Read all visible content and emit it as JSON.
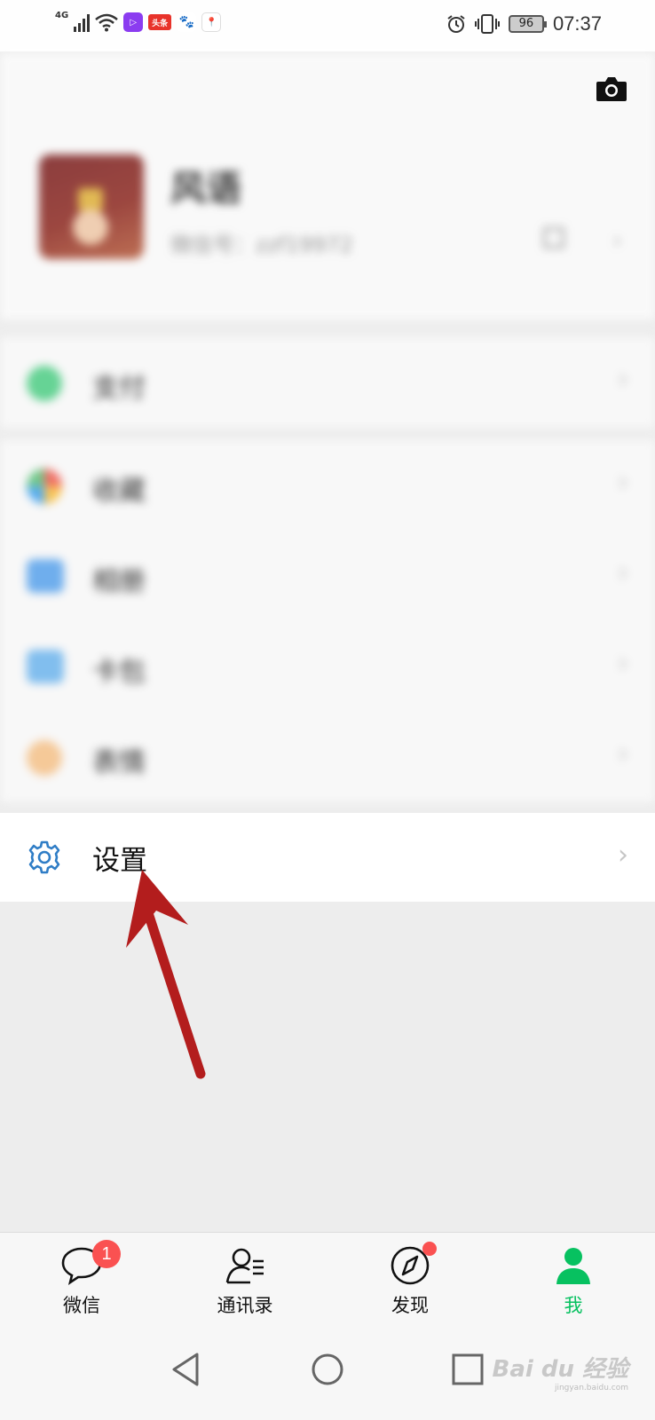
{
  "status_bar": {
    "network": "4G",
    "app_icon_toutiao": "头条",
    "battery": "96",
    "time": "07:37"
  },
  "profile": {
    "name": "风语",
    "wechat_id": "微信号：zzf19972"
  },
  "menu": {
    "pay": "支付",
    "favorites": "收藏",
    "album": "相册",
    "cards": "卡包",
    "stickers": "表情",
    "settings": "设置"
  },
  "chevron": "›",
  "tabs": [
    {
      "label": "微信",
      "badge": "1"
    },
    {
      "label": "通讯录"
    },
    {
      "label": "发现"
    },
    {
      "label": "我"
    }
  ],
  "watermark": {
    "brand": "Bai du 经验",
    "url": "jingyan.baidu.com"
  },
  "colors": {
    "accent": "#07c160",
    "badge": "#fa5151",
    "arrow": "#b31d1d",
    "gear": "#2f7dc6"
  }
}
